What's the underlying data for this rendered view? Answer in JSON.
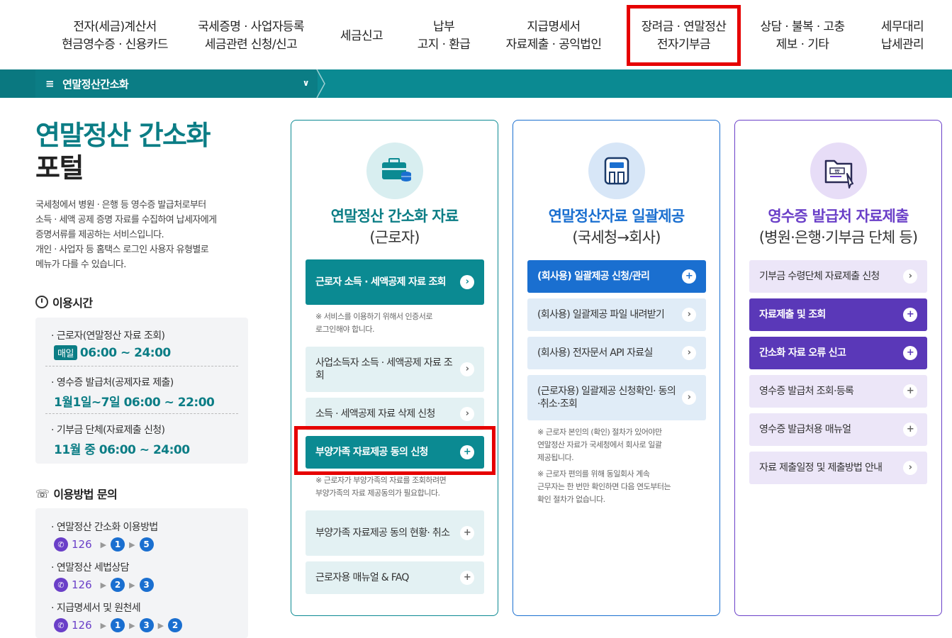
{
  "topnav": {
    "items": [
      {
        "line1": "전자(세금)계산서",
        "line2": "현금영수증 · 신용카드"
      },
      {
        "line1": "국세증명 · 사업자등록",
        "line2": "세금관련 신청/신고"
      },
      {
        "line1": "세금신고",
        "line2": ""
      },
      {
        "line1": "납부",
        "line2": "고지 · 환급"
      },
      {
        "line1": "지급명세서",
        "line2": "자료제출 · 공익법인"
      },
      {
        "line1": "장려금 · 연말정산",
        "line2": "전자기부금"
      },
      {
        "line1": "상담 · 불복 · 고충",
        "line2": "제보 · 기타"
      },
      {
        "line1": "세무대리",
        "line2": "납세관리"
      }
    ]
  },
  "menubar": {
    "label": "연말정산간소화",
    "hamburger": "≡",
    "chevron": "∨"
  },
  "portal": {
    "title1": "연말정산 간소화",
    "title2": "포털",
    "desc1": "국세청에서 병원 · 은행 등 영수증 발급처로부터",
    "desc2": "소득 · 세액 공제 증명 자료를 수집하여 납세자에게",
    "desc3": "증명서류를 제공하는 서비스입니다.",
    "desc4": "개인 · 사업자 등 홈택스 로그인 사용자 유형별로",
    "desc5": "메뉴가 다를 수 있습니다."
  },
  "hours": {
    "heading": "이용시간",
    "rows": [
      {
        "label": "근로자(연말정산 자료 조회)",
        "badge": "매일",
        "value": "06:00 ~ 24:00"
      },
      {
        "label": "영수증 발급처(공제자료 제출)",
        "value": "1월1일~7일 06:00 ~ 22:00"
      },
      {
        "label": "기부금 단체(자료제출 신청)",
        "value": "11월 중 06:00 ~ 24:00"
      }
    ]
  },
  "inquiry": {
    "heading": "이용방법 문의",
    "phone": "126",
    "rows": [
      {
        "label": "연말정산 간소화 이용방법",
        "seq": [
          "1",
          "5"
        ]
      },
      {
        "label": "연말정산 세법상담",
        "seq": [
          "2",
          "3"
        ]
      },
      {
        "label": "지급명세서 및 원천세",
        "seq": [
          "1",
          "3",
          "2"
        ]
      }
    ]
  },
  "card1": {
    "title": "연말정산 간소화 자료",
    "subtitle": "(근로자)",
    "btn1": "근로자 소득 · 세액공제 자료 조회",
    "note1a": "※ 서비스를 이용하기 위해서 인증서로",
    "note1b": "로그인해야 합니다.",
    "btn2": "사업소득자 소득 · 세액공제 자료 조회",
    "btn3": "소득 · 세액공제 자료 삭제 신청",
    "btn4": "부양가족 자료제공 동의 신청",
    "note2a": "※ 근로자가 부양가족의 자료를 조회하려면",
    "note2b": "부양가족의 자료 제공동의가 필요합니다.",
    "btn5": "부양가족 자료제공 동의 현황· 취소",
    "btn6": "근로자용 매뉴얼 & FAQ"
  },
  "card2": {
    "title": "연말정산자료 일괄제공",
    "subtitle": "(국세청→회사)",
    "btn1": "(회사용) 일괄제공 신청/관리",
    "btn2": "(회사용) 일괄제공 파일 내려받기",
    "btn3": "(회사용) 전자문서 API 자료실",
    "btn4": "(근로자용) 일괄제공 신청확인· 동의·취소·조회",
    "note1a": "※ 근로자 본인의 (확인) 절차가 있어야만",
    "note1b": "연말정산 자료가 국세청에서 회사로 일괄",
    "note1c": "제공됩니다.",
    "note2a": "※ 근로자 편의를 위해 동일회사 계속",
    "note2b": "근무자는 한 번만 확인하면 다음 연도부터는",
    "note2c": "확인 절차가 없습니다."
  },
  "card3": {
    "title": "영수증 발급처 자료제출",
    "subtitle": "(병원·은행·기부금 단체 등)",
    "btn1": "기부금 수령단체 자료제출 신청",
    "btn2": "자료제출 및 조회",
    "btn3": "간소화 자료 오류 신고",
    "btn4": "영수증 발급처 조회·등록",
    "btn5": "영수증 발급처용 매뉴얼",
    "btn6": "자료 제출일정 및 제출방법 안내"
  },
  "colors": {
    "teal": "#0b8a92",
    "blue": "#1a6fd0",
    "purple": "#6a3fc8",
    "highlight": "#e60000"
  }
}
